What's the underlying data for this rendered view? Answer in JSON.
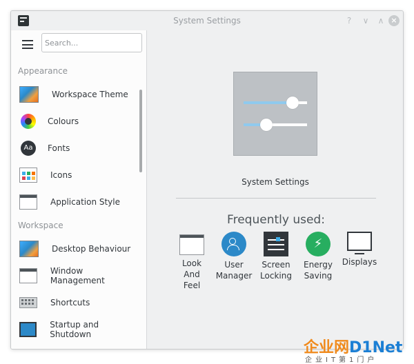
{
  "window": {
    "title": "System Settings",
    "buttons": {
      "help": "?",
      "minimize": "∨",
      "maximize": "∧",
      "close": "×"
    }
  },
  "search": {
    "placeholder": "Search..."
  },
  "sidebar": {
    "sections": [
      {
        "label": "Appearance",
        "items": [
          {
            "label": "Workspace Theme",
            "icon": "workspace-theme-icon"
          },
          {
            "label": "Colours",
            "icon": "colours-icon"
          },
          {
            "label": "Fonts",
            "icon": "fonts-icon",
            "glyph": "Aa"
          },
          {
            "label": "Icons",
            "icon": "icons-icon"
          },
          {
            "label": "Application Style",
            "icon": "application-style-icon"
          }
        ]
      },
      {
        "label": "Workspace",
        "items": [
          {
            "label": "Desktop Behaviour",
            "icon": "desktop-behaviour-icon"
          },
          {
            "label": "Window Management",
            "icon": "window-management-icon"
          },
          {
            "label": "Shortcuts",
            "icon": "shortcuts-icon"
          },
          {
            "label": "Startup and Shutdown",
            "icon": "startup-shutdown-icon"
          }
        ]
      }
    ]
  },
  "main": {
    "hero_label": "System Settings",
    "frequently_used_title": "Frequently used:",
    "frequent": [
      {
        "line1": "Look",
        "line2": "And",
        "line3": "Feel",
        "icon": "look-and-feel-icon"
      },
      {
        "line1": "User",
        "line2": "Manager",
        "line3": "",
        "icon": "user-manager-icon"
      },
      {
        "line1": "Screen",
        "line2": "Locking",
        "line3": "",
        "icon": "screen-locking-icon"
      },
      {
        "line1": "Energy",
        "line2": "Saving",
        "line3": "",
        "icon": "energy-saving-icon",
        "glyph": "⚡"
      },
      {
        "line1": "Displays",
        "line2": "",
        "line3": "",
        "icon": "displays-icon"
      }
    ]
  },
  "watermark": {
    "part_a": "企业网",
    "part_b": "D1Net",
    "bottom": "企业IT第1门户"
  },
  "colors": {
    "accent": "#3daee9",
    "sidebar_bg": "#fcfcfc",
    "window_bg": "#eff0f1"
  }
}
